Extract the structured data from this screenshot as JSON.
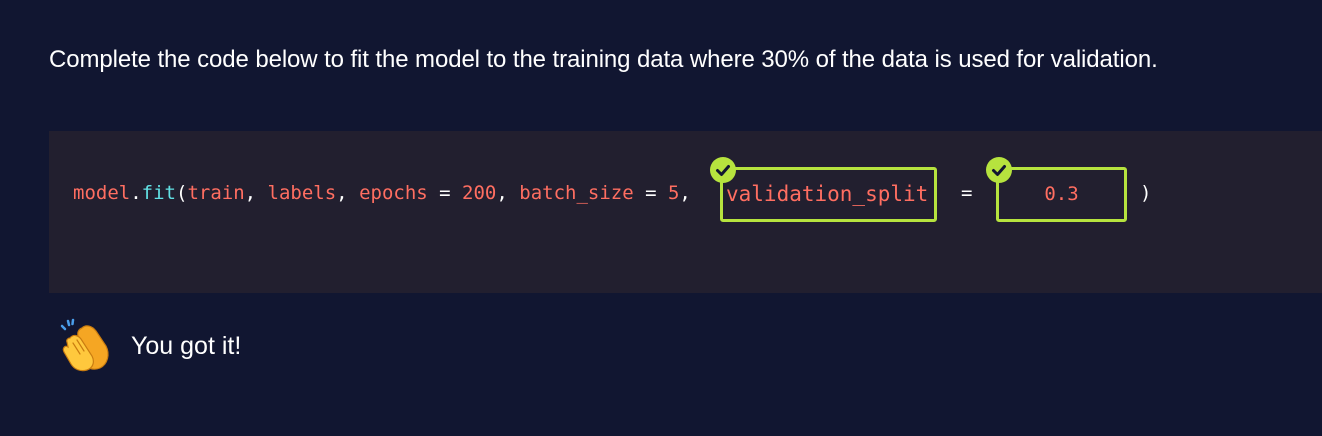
{
  "prompt": "Complete the code below to fit the model to the training data where 30% of the data is used for validation.",
  "code": {
    "obj": "model",
    "dot": ".",
    "method": "fit",
    "open": "(",
    "arg1": "train",
    "comma1": ", ",
    "arg2": "labels",
    "comma2": ", ",
    "arg3_name": "epochs",
    "eq1": " = ",
    "arg3_val": "200",
    "comma3": ", ",
    "arg4_name": "batch_size",
    "eq2": " = ",
    "arg4_val": "5",
    "comma4": ",",
    "eq3": "=",
    "close": ")"
  },
  "blanks": {
    "key_answer": "validation_split",
    "value_answer": "0.3",
    "status": "correct"
  },
  "feedback": {
    "icon": "clapping-hands-icon",
    "text": "You got it!"
  },
  "colors": {
    "background": "#111631",
    "code_panel": "#221f2f",
    "identifier": "#ff6e61",
    "function": "#62e1e5",
    "correct_accent": "#b6e33e"
  }
}
